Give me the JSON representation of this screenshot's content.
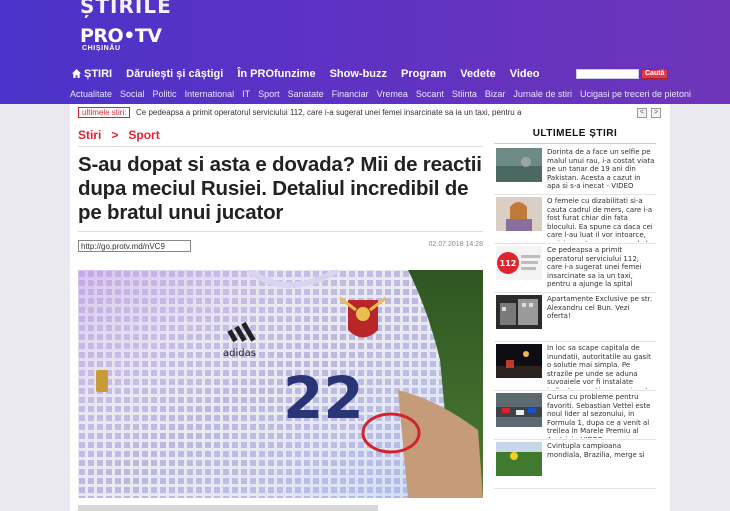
{
  "header": {
    "brand_top": "ȘTIRILE",
    "brand_logo": "PRO•TV",
    "brand_sub": "CHIȘINĂU",
    "nav": [
      "ȘTIRI",
      "Dăruiești și câștigi",
      "În PROfunzime",
      "Show-buzz",
      "Program",
      "Vedete",
      "Video"
    ],
    "search_placeholder": "",
    "search_button": "Caută",
    "subnav": [
      "Actualitate",
      "Social",
      "Politic",
      "International",
      "IT",
      "Sport",
      "Sanatate",
      "Financiar",
      "Vremea",
      "Socant",
      "Stiinta",
      "Bizar",
      "Jurnale de stiri",
      "Ucigasi pe treceri de pietoni"
    ]
  },
  "ticker": {
    "badge": "ultimele stiri:",
    "text": "Ce pedeapsa a primit operatorul serviciului 112, care i-a sugerat unei femei insarcinate sa ia un taxi, pentru a",
    "prev": "<",
    "next": ">"
  },
  "article": {
    "breadcrumb": [
      "Stiri",
      "Sport"
    ],
    "breadcrumb_sep": ">",
    "title": "S-au dopat si asta e dovada? Mii de reactii dupa meciul Rusiei. Detaliul incredibil de pe bratul unui jucator",
    "shortlink": "http://go.protv.md/nVC9",
    "datetime": "02.07.2018 14:28",
    "jersey_number": "22"
  },
  "sidebar": {
    "title": "ULTIMELE ȘTIRI",
    "items": [
      {
        "text": "Dorinta de a face un selfie pe malul unui rau, i-a costat viata pe un tanar de 19 ani din Pakistan. Acesta a cazut in apa si s-a inecat - VIDEO"
      },
      {
        "text": "O femeie cu dizabilitati si-a cauta cadrul de mers, care i-a fost furat chiar din fata blocului. Ea spune ca daca cei care l-au luat il vor intoarce, ea isi va retrage cererea de la politie. Cum s-a intamplat totul - VIDEO"
      },
      {
        "text": "Ce pedeapsa a primit operatorul serviciului 112, care i-a sugerat unei femei insarcinate sa ia un taxi, pentru a ajunge la spital"
      },
      {
        "text": "Apartamente Exclusive pe str. Alexandru cel Bun. Vezi oferta!"
      },
      {
        "text": "In loc sa scape capitala de inundatii, autoritatile au gasit o solutie mai simpla. Pe strazile pe unde se aduna suvoaiele vor fi instalate indicatoare rutiere, asa incat soferii sa le ocoleasca - VIDEO"
      },
      {
        "text": "Cursa cu probleme pentru favoriti. Sebastian Vettel este noul lider al sezonului, in Formula 1, dupa ce a venit al treilea in Marele Premiu al Austriei - VIDEO"
      },
      {
        "text": "Cvintupla campioana mondiala, Brazilia, merge si"
      }
    ],
    "thumb_badge": "112"
  },
  "colors": {
    "header_start": "#4a33c9",
    "header_end": "#6e35b9",
    "accent_red": "#e0242f"
  }
}
